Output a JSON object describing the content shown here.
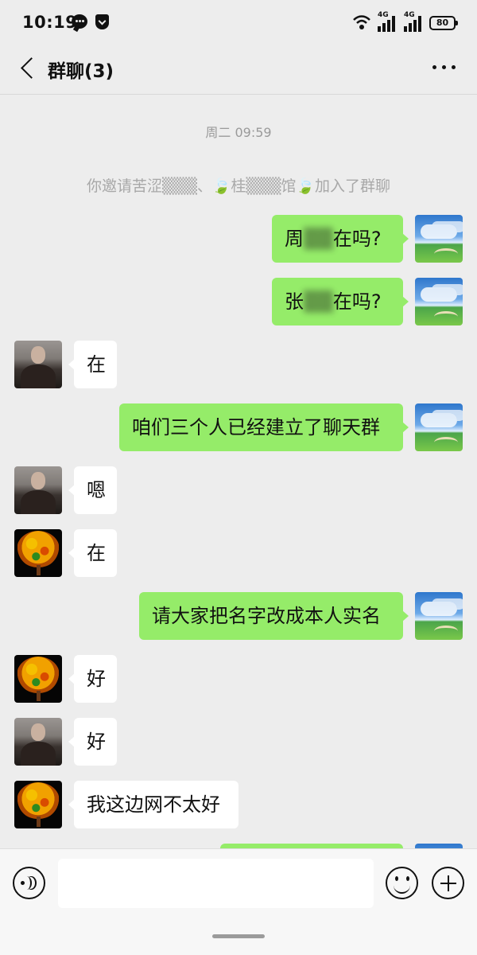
{
  "status_bar": {
    "time": "10:19",
    "signal1_label": "4G",
    "signal2_label": "4G",
    "battery_level": "80"
  },
  "header": {
    "title": "群聊(3)"
  },
  "chat": {
    "timestamp": "周二 09:59",
    "system_message": "你邀请苦涩▒▒▒、🍃桂▒▒▒馆🍃加入了群聊",
    "messages": [
      {
        "side": "right",
        "text_a": "周",
        "text_blur": "▒▒",
        "text_b": "在吗?",
        "avatar": "sky-avatar"
      },
      {
        "side": "right",
        "text_a": "张",
        "text_blur": "▒▒",
        "text_b": "在吗?",
        "avatar": "sky-avatar"
      },
      {
        "side": "left",
        "text": "在",
        "avatar": "man-avatar"
      },
      {
        "side": "right",
        "text": "咱们三个人已经建立了聊天群",
        "avatar": "sky-avatar"
      },
      {
        "side": "left",
        "text": "嗯",
        "avatar": "man-avatar"
      },
      {
        "side": "left",
        "text": "在",
        "avatar": "tree-avatar"
      },
      {
        "side": "right",
        "text": "请大家把名字改成本人实名",
        "avatar": "sky-avatar"
      },
      {
        "side": "left",
        "text": "好",
        "avatar": "tree-avatar"
      },
      {
        "side": "left",
        "text": "好",
        "avatar": "man-avatar"
      },
      {
        "side": "left",
        "text": "我这边网不太好",
        "avatar": "tree-avatar"
      }
    ]
  },
  "input_bar": {
    "message_value": "",
    "icons": [
      "voice-icon",
      "emoji-icon",
      "plus-icon"
    ]
  },
  "colors": {
    "sent_bubble": "#95ec69",
    "received_bubble": "#ffffff",
    "background": "#ededed"
  }
}
